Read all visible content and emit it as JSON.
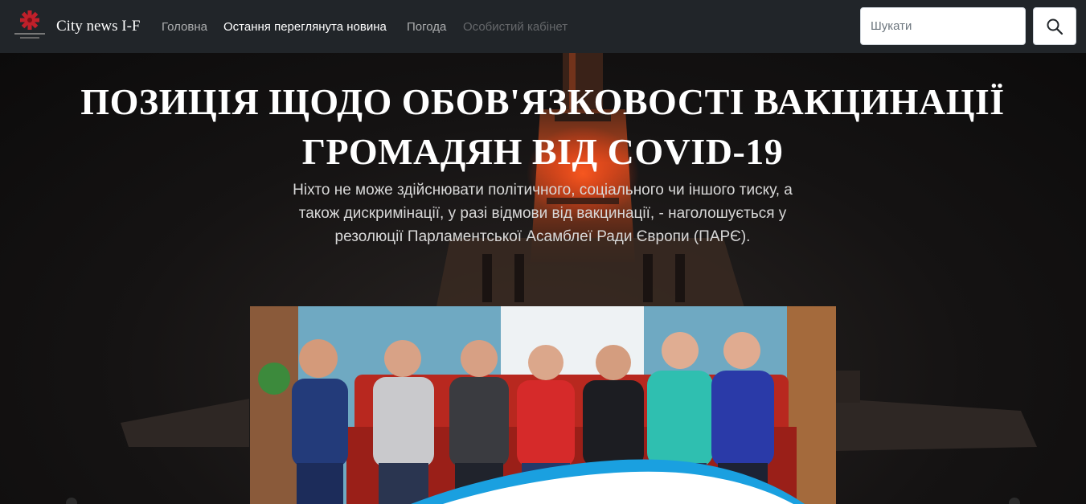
{
  "navbar": {
    "brand": "City news I-F",
    "links": [
      {
        "label": "Головна"
      },
      {
        "label": "Остання переглянута новина"
      },
      {
        "label": "Погода"
      },
      {
        "label": "Особистий кабінет"
      }
    ],
    "search": {
      "placeholder": "Шукати"
    }
  },
  "article": {
    "title": "ПОЗИЦІЯ ЩОДО ОБОВ'ЯЗКОВОСТІ ВАКЦИНАЦІЇ ГРОМАДЯН ВІД COVID-19",
    "lead": "Ніхто не може здійснювати політичного, соціального чи іншого тиску, а також дискримінації, у разі відмови від вакцинації, - наголошується у резолюції Парламентської Асамблеї Ради Європи (ПАРЄ)."
  },
  "colors": {
    "navbar_bg": "#212529",
    "accent_red": "#c0202a",
    "wave_blue": "#1aa0e0"
  }
}
